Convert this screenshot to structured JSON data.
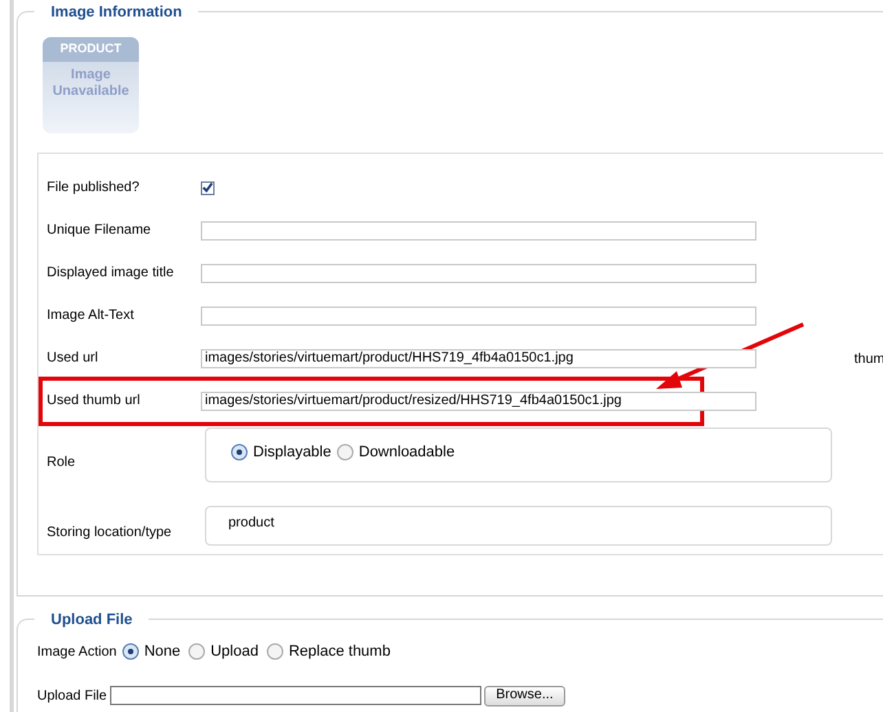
{
  "image_info": {
    "title": "Image Information",
    "placeholder_image": {
      "top": "PRODUCT",
      "text": "Image Unavailable"
    },
    "rows": [
      {
        "kind": "checkbox",
        "label": "File published?",
        "checked": true
      },
      {
        "kind": "text",
        "label": "Unique Filename"
      },
      {
        "kind": "text",
        "label": "Displayed image title"
      },
      {
        "kind": "text",
        "label": "Image Alt-Text"
      },
      {
        "kind": "text",
        "label": "Used url",
        "value": "images/stories/virtuemart/product/HHS719_4fb4a0150c1.jpg",
        "side_text": "thum"
      },
      {
        "kind": "text",
        "label": "Used thumb url",
        "value": "images/stories/virtuemart/product/resized/HHS719_4fb4a0150c1.jpg",
        "highlighted": true
      }
    ],
    "role": {
      "label": "Role",
      "options": [
        {
          "label": "Displayable",
          "selected": true
        },
        {
          "label": "Downloadable",
          "selected": false
        }
      ]
    },
    "storing": {
      "label": "Storing location/type",
      "value": "product"
    }
  },
  "upload": {
    "title": "Upload File",
    "image_action": {
      "label": "Image Action",
      "options": [
        {
          "label": "None",
          "selected": true
        },
        {
          "label": "Upload",
          "selected": false
        },
        {
          "label": "Replace thumb",
          "selected": false
        }
      ]
    },
    "file": {
      "label": "Upload File",
      "button": "Browse..."
    }
  }
}
